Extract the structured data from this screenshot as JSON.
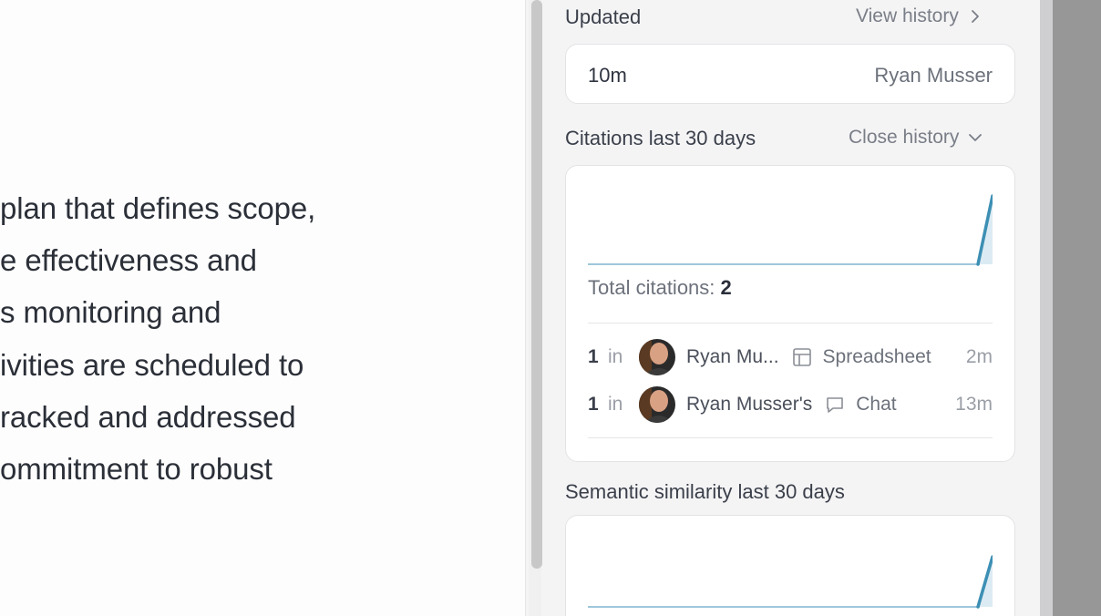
{
  "document": {
    "lines": [
      "plan that defines scope,",
      "e effectiveness and",
      "s monitoring and",
      "ivities are scheduled to",
      "racked and addressed",
      "ommitment to robust"
    ]
  },
  "panel": {
    "updated": {
      "label": "Updated",
      "view_history": "View history",
      "age": "10m",
      "user": "Ryan Musser"
    },
    "citations": {
      "label": "Citations last 30 days",
      "close_history": "Close history",
      "total_label": "Total citations:",
      "total_value": "2",
      "rows": [
        {
          "count": "1",
          "in": "in",
          "user": "Ryan Mu...",
          "source_icon": "table-icon",
          "source": "Spreadsheet",
          "time": "2m"
        },
        {
          "count": "1",
          "in": "in",
          "user": "Ryan Musser's",
          "source_icon": "chat-bubble-icon",
          "source": "Chat",
          "time": "13m"
        }
      ]
    },
    "semantic": {
      "label": "Semantic similarity last 30 days"
    }
  },
  "colors": {
    "chart_line": "#3d8fb4",
    "chart_fill": "#dcebf3",
    "panel_bg": "#f4f4f5"
  }
}
